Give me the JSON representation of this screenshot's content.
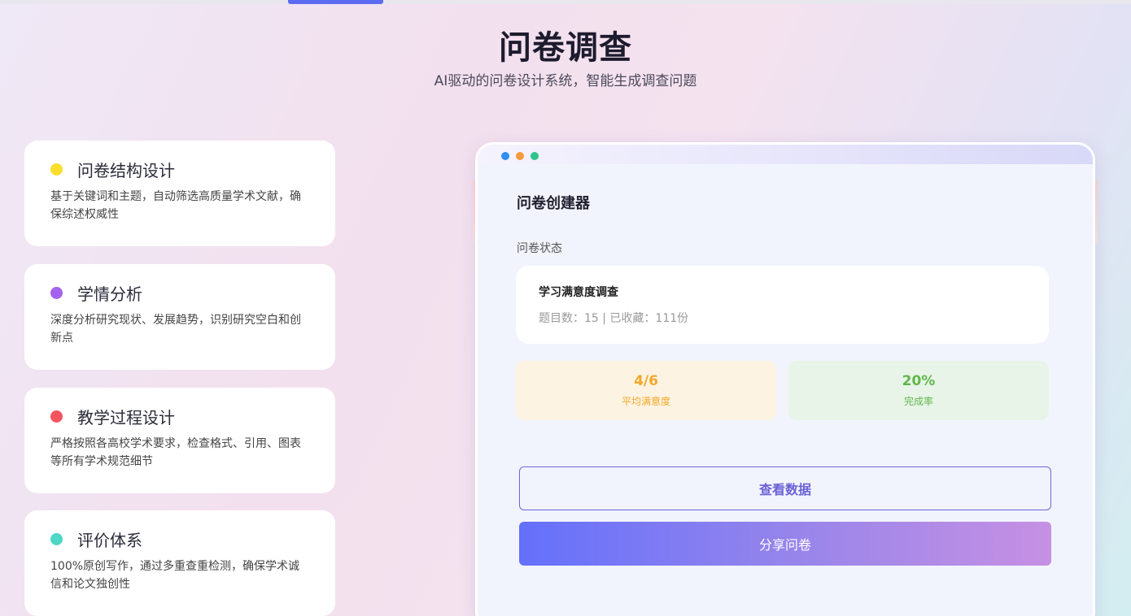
{
  "header": {
    "title": "问卷调查",
    "subtitle": "AI驱动的问卷设计系统，智能生成调查问题"
  },
  "features": [
    {
      "title": "问卷结构设计",
      "desc": "基于关键词和主题，自动筛选高质量学术文献，确保综述权威性",
      "color": "#fbdd2b"
    },
    {
      "title": "学情分析",
      "desc": "深度分析研究现状、发展趋势，识别研究空白和创新点",
      "color": "#a463ee"
    },
    {
      "title": "教学过程设计",
      "desc": "严格按照各高校学术要求，检查格式、引用、图表等所有学术规范细节",
      "color": "#f5535f"
    },
    {
      "title": "评价体系",
      "desc": "100%原创写作，通过多重查重检测，确保学术诚信和论文独创性",
      "color": "#4ed7c6"
    }
  ],
  "creator": {
    "window_dots": [
      "#2f8ef2",
      "#f39a3d",
      "#2fc48c"
    ],
    "title": "问卷创建器",
    "status_label": "问卷状态",
    "survey": {
      "name": "学习满意度调查",
      "meta": "题目数：15 | 已收藏：111份"
    },
    "stats": [
      {
        "value": "4/6",
        "label": "平均满意度"
      },
      {
        "value": "20%",
        "label": "完成率"
      }
    ],
    "view_data_button": "查看数据",
    "share_button": "分享问卷"
  }
}
